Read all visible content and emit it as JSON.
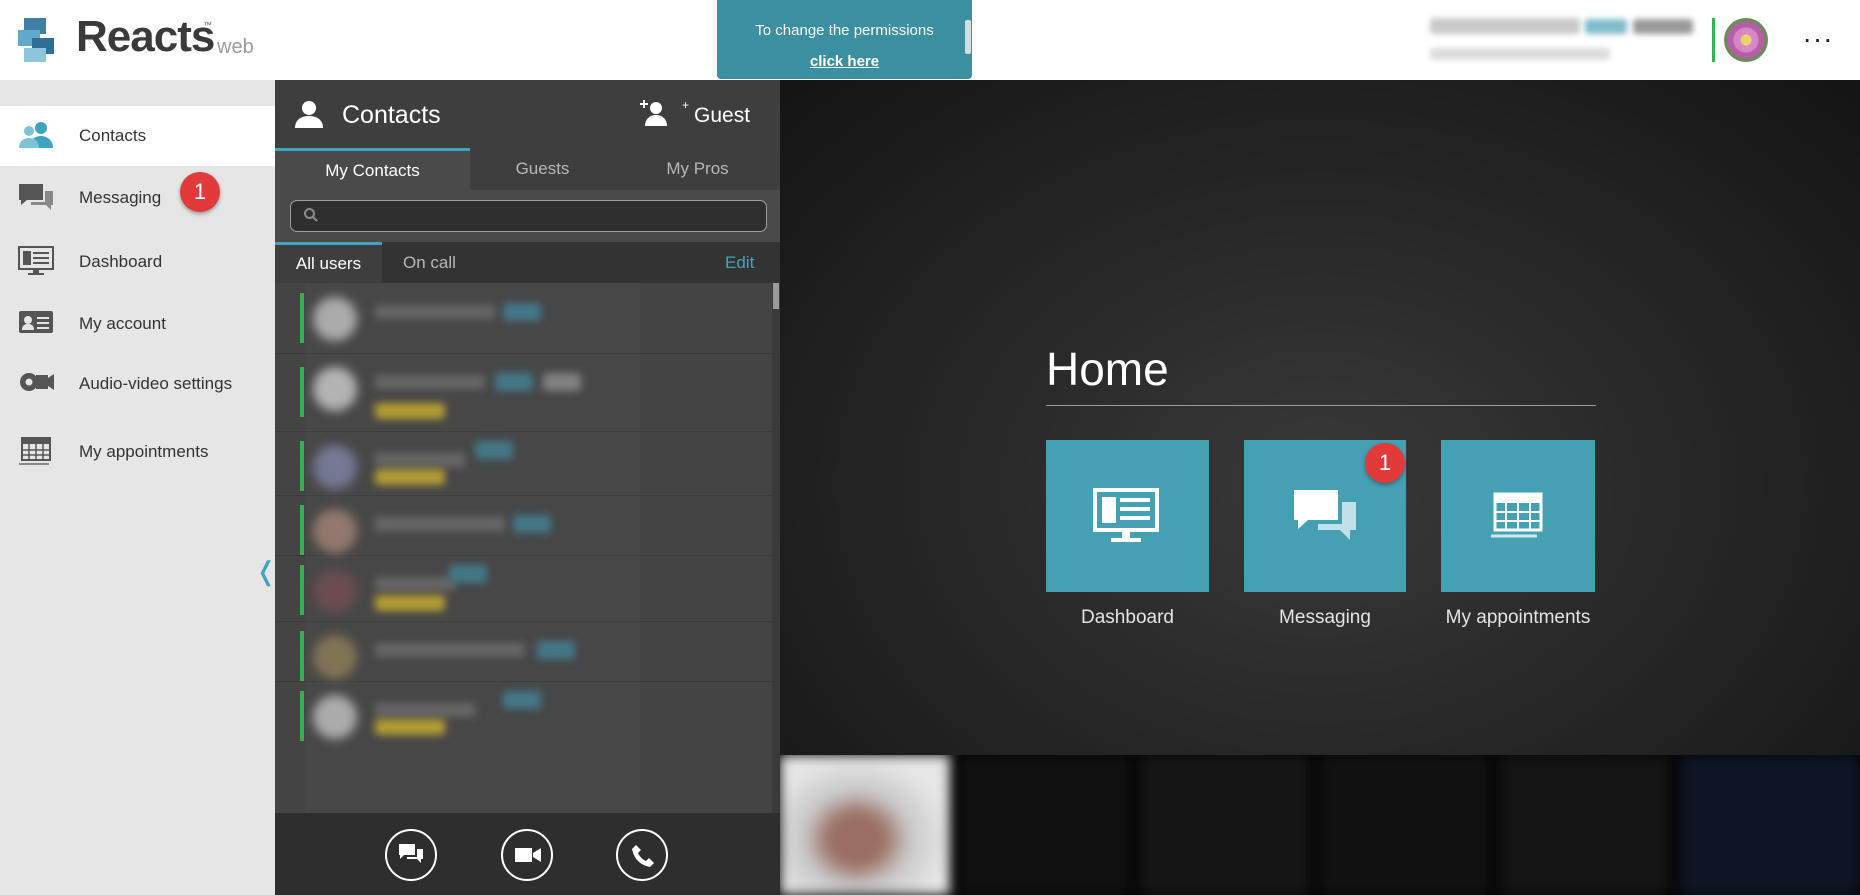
{
  "app": {
    "name": "Reacts",
    "trademark": "™",
    "suffix": "web"
  },
  "banner": {
    "text": "To change the permissions",
    "link": "click here"
  },
  "user": {
    "more_label": "···"
  },
  "sidebar": {
    "items": [
      {
        "label": "Contacts",
        "icon": "contacts-icon"
      },
      {
        "label": "Messaging",
        "icon": "messaging-icon",
        "badge": "1"
      },
      {
        "label": "Dashboard",
        "icon": "dashboard-icon"
      },
      {
        "label": "My account",
        "icon": "account-card-icon"
      },
      {
        "label": "Audio-video settings",
        "icon": "camera-settings-icon"
      },
      {
        "label": "My appointments",
        "icon": "calendar-icon"
      }
    ],
    "collapse": "❬"
  },
  "contacts": {
    "title": "Contacts",
    "guest_plus": "+",
    "guest_label": "Guest",
    "tabs": [
      "My Contacts",
      "Guests",
      "My Pros"
    ],
    "search_placeholder": "",
    "filters": {
      "all": "All users",
      "oncall": "On call",
      "edit": "Edit"
    }
  },
  "home": {
    "title": "Home",
    "tiles": [
      {
        "label": "Dashboard",
        "icon": "dashboard-icon"
      },
      {
        "label": "Messaging",
        "icon": "messaging-icon",
        "badge": "1"
      },
      {
        "label": "My appointments",
        "icon": "calendar-icon"
      }
    ]
  },
  "colors": {
    "accent": "#45a0b4",
    "badge": "#e23a3a",
    "online": "#35b24a",
    "banner": "#3a8fa0"
  }
}
